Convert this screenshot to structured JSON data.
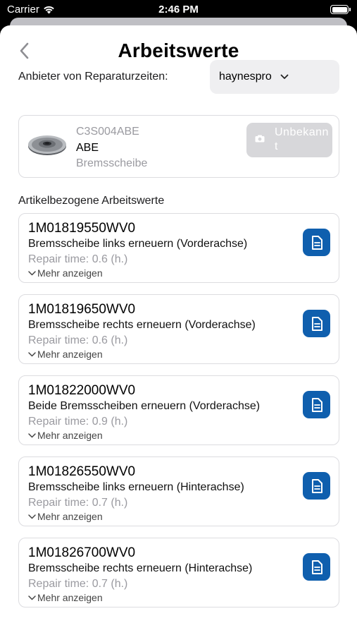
{
  "status_bar": {
    "carrier": "Carrier",
    "time": "2:46 PM"
  },
  "header": {
    "title": "Arbeitswerte",
    "back_icon": "chevron-left-icon"
  },
  "provider": {
    "label": "Anbieter von Reparaturzeiten:",
    "selected": "haynespro"
  },
  "product": {
    "code": "C3S004ABE",
    "brand": "ABE",
    "type": "Bremsscheibe",
    "status_button": "Unbekannt"
  },
  "section_title": "Artikelbezogene Arbeitswerte",
  "work_items": [
    {
      "code": "1M01819550WV0",
      "description": "Bremsscheibe links erneuern (Vorderachse)",
      "time": "Repair time: 0.6 (h.)",
      "more": "Mehr anzeigen"
    },
    {
      "code": "1M01819650WV0",
      "description": "Bremsscheibe rechts erneuern (Vorderachse)",
      "time": "Repair time: 0.6 (h.)",
      "more": "Mehr anzeigen"
    },
    {
      "code": "1M01822000WV0",
      "description": "Beide Bremsscheiben erneuern (Vorderachse)",
      "time": "Repair time: 0.9 (h.)",
      "more": "Mehr anzeigen"
    },
    {
      "code": "1M01826550WV0",
      "description": "Bremsscheibe links erneuern (Hinterachse)",
      "time": "Repair time: 0.7 (h.)",
      "more": "Mehr anzeigen"
    },
    {
      "code": "1M01826700WV0",
      "description": "Bremsscheibe rechts erneuern (Hinterachse)",
      "time": "Repair time: 0.7 (h.)",
      "more": "Mehr anzeigen"
    }
  ],
  "colors": {
    "accent": "#0f5fae",
    "muted_text": "#9a9aa0",
    "disabled_button": "#d7d7da"
  }
}
